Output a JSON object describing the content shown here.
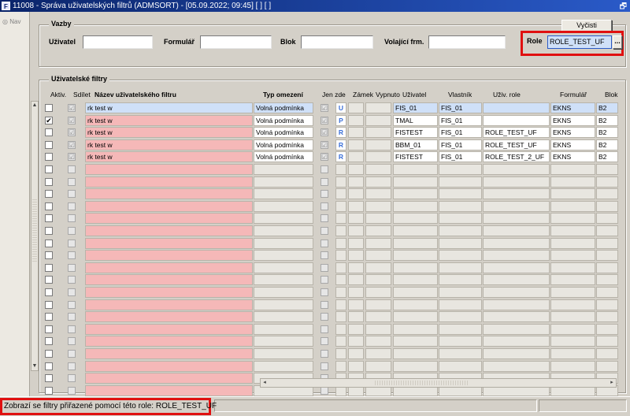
{
  "window": {
    "title": "11008 - Správa uživatelských filtrů (ADMSORT) - [05.09.2022; 09:45] [ ] [ ]",
    "app_icon": "F",
    "restore_glyph": "🗗"
  },
  "nav": {
    "label": "Nav",
    "icon": "nav-icon"
  },
  "vazby": {
    "title": "Vazby",
    "clear_button": "Vyčisti",
    "uzivatel_label": "Uživatel",
    "uzivatel_value": "",
    "formular_label": "Formulář",
    "formular_value": "",
    "blok_label": "Blok",
    "blok_value": "",
    "volajici_label": "Volající frm.",
    "volajici_value": "",
    "role_label": "Role",
    "role_value": "ROLE_TEST_UF",
    "role_lov": "..."
  },
  "filters": {
    "title": "Uživatelské filtry",
    "headers": {
      "aktiv": "Aktiv.",
      "sdilet": "Sdílet",
      "nazev": "Název uživatelského filtru",
      "typ": "Typ omezení",
      "jenzde": "Jen zde",
      "zamek": "Zámek",
      "vypnuto": "Vypnuto",
      "uzivatel": "Uživatel",
      "vlastnik": "Vlastník",
      "role": "Uživ. role",
      "formular": "Formulář",
      "blok": "Blok"
    },
    "rows": [
      {
        "aktiv": "",
        "sdilet": "☑",
        "nazev": "rk test w",
        "typ": "Volná podmínka",
        "jenzde": "☑",
        "zamek": "U",
        "vypnuto": "",
        "uzivatel": "FIS_01",
        "vlastnik": "FIS_01",
        "role": "",
        "formular": "EKNS",
        "blok": "B2"
      },
      {
        "aktiv": "✔",
        "sdilet": "☑",
        "nazev": "rk test w",
        "typ": "Volná podmínka",
        "jenzde": "☑",
        "zamek": "P",
        "vypnuto": "",
        "uzivatel": "TMAL",
        "vlastnik": "FIS_01",
        "role": "",
        "formular": "EKNS",
        "blok": "B2"
      },
      {
        "aktiv": "",
        "sdilet": "☑",
        "nazev": "rk test w",
        "typ": "Volná podmínka",
        "jenzde": "☑",
        "zamek": "R",
        "vypnuto": "",
        "uzivatel": "FISTEST",
        "vlastnik": "FIS_01",
        "role": "ROLE_TEST_UF",
        "formular": "EKNS",
        "blok": "B2"
      },
      {
        "aktiv": "",
        "sdilet": "☑",
        "nazev": "rk test w",
        "typ": "Volná podmínka",
        "jenzde": "☑",
        "zamek": "R",
        "vypnuto": "",
        "uzivatel": "BBM_01",
        "vlastnik": "FIS_01",
        "role": "ROLE_TEST_UF",
        "formular": "EKNS",
        "blok": "B2"
      },
      {
        "aktiv": "",
        "sdilet": "☑",
        "nazev": "rk test w",
        "typ": "Volná podmínka",
        "jenzde": "☑",
        "zamek": "R",
        "vypnuto": "",
        "uzivatel": "FISTEST",
        "vlastnik": "FIS_01",
        "role": "ROLE_TEST_2_UF",
        "formular": "EKNS",
        "blok": "B2"
      }
    ],
    "empty_rows": 22
  },
  "status": {
    "message": "Zobrazí se filtry přiřazené pomocí této role: ROLE_TEST_UF"
  }
}
